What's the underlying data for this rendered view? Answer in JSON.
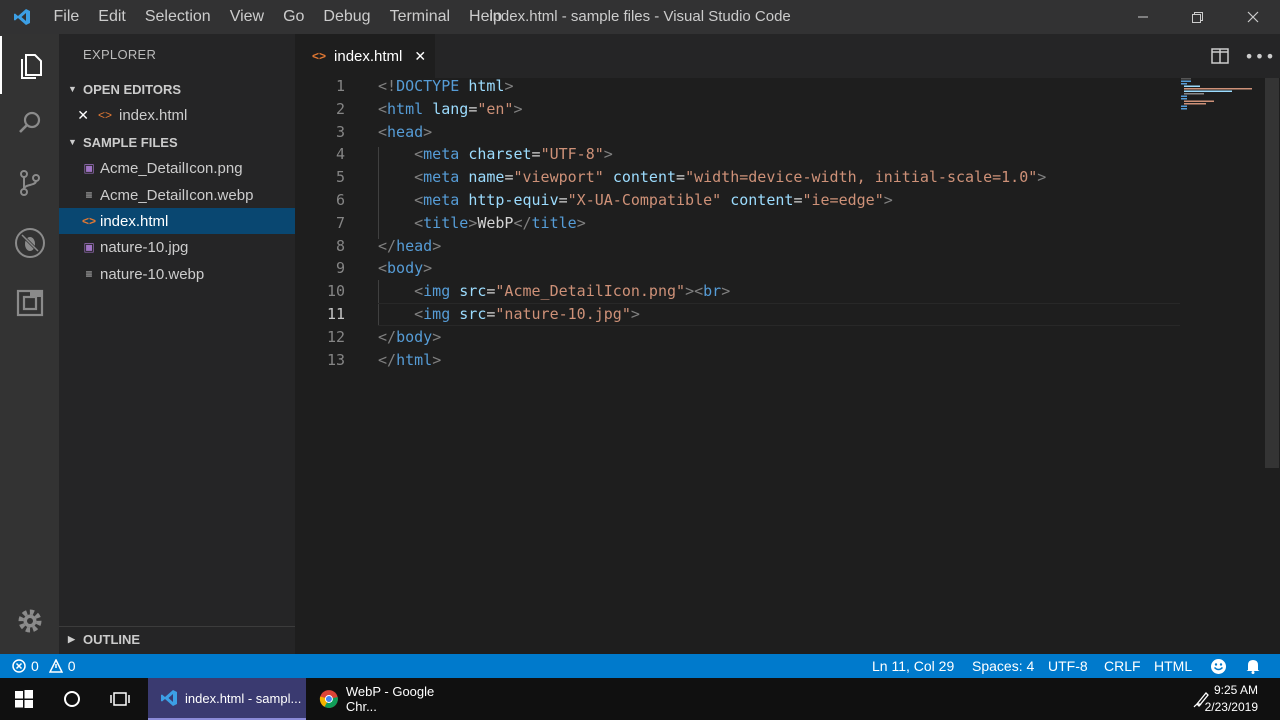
{
  "window": {
    "title": "index.html - sample files - Visual Studio Code",
    "menu": [
      "File",
      "Edit",
      "Selection",
      "View",
      "Go",
      "Debug",
      "Terminal",
      "Help"
    ]
  },
  "sidebar": {
    "title": "EXPLORER",
    "open_editors": {
      "label": "OPEN EDITORS",
      "items": [
        {
          "name": "index.html",
          "icon": "html-file-icon"
        }
      ]
    },
    "folder": {
      "label": "SAMPLE FILES",
      "files": [
        {
          "name": "Acme_DetailIcon.png",
          "icon": "image-file-icon"
        },
        {
          "name": "Acme_DetailIcon.webp",
          "icon": "generic-file-icon"
        },
        {
          "name": "index.html",
          "icon": "html-file-icon",
          "selected": true
        },
        {
          "name": "nature-10.jpg",
          "icon": "image-file-icon"
        },
        {
          "name": "nature-10.webp",
          "icon": "generic-file-icon"
        }
      ]
    },
    "outline_label": "OUTLINE"
  },
  "tab": {
    "label": "index.html"
  },
  "editor": {
    "line_numbers": [
      "1",
      "2",
      "3",
      "4",
      "5",
      "6",
      "7",
      "8",
      "9",
      "10",
      "11",
      "12",
      "13"
    ],
    "current_line": "11",
    "lines": [
      "<!DOCTYPE html>",
      "<html lang=\"en\">",
      "<head>",
      "    <meta charset=\"UTF-8\">",
      "    <meta name=\"viewport\" content=\"width=device-width, initial-scale=1.0\">",
      "    <meta http-equiv=\"X-UA-Compatible\" content=\"ie=edge\">",
      "    <title>WebP</title>",
      "</head>",
      "<body>",
      "    <img src=\"Acme_DetailIcon.png\"><br>",
      "    <img src=\"nature-10.jpg\">",
      "</body>",
      "</html>"
    ]
  },
  "statusbar": {
    "errors": "0",
    "warnings": "0",
    "position": "Ln 11, Col 29",
    "spaces": "Spaces: 4",
    "encoding": "UTF-8",
    "eol": "CRLF",
    "language": "HTML"
  },
  "taskbar": {
    "apps": [
      {
        "label": "index.html - sampl...",
        "icon": "vscode-icon",
        "active": true
      },
      {
        "label": "WebP - Google Chr...",
        "icon": "chrome-icon",
        "active": false
      }
    ],
    "time": "9:25 AM",
    "date": "2/23/2019"
  },
  "colors": {
    "accent": "#007acc",
    "selection": "#094771",
    "tag": "#569cd6",
    "attribute": "#9cdcfe",
    "string": "#ce9178"
  }
}
